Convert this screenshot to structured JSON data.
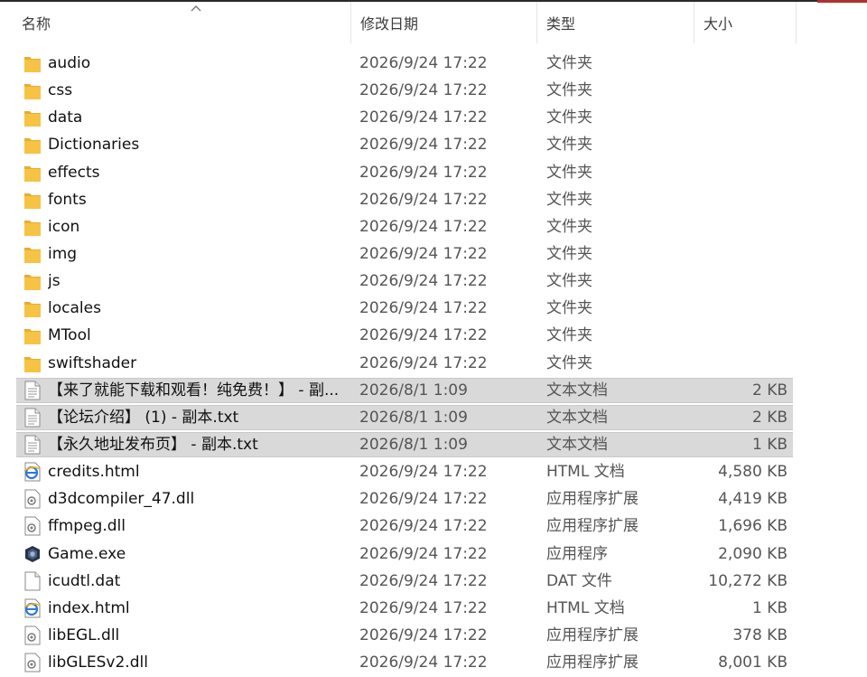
{
  "columns": {
    "name": "名称",
    "date": "修改日期",
    "type": "类型",
    "size": "大小"
  },
  "files": [
    {
      "name": "audio",
      "date": "2026/9/24 17:22",
      "type": "文件夹",
      "size": "",
      "icon": "folder-icon",
      "selected": false
    },
    {
      "name": "css",
      "date": "2026/9/24 17:22",
      "type": "文件夹",
      "size": "",
      "icon": "folder-icon",
      "selected": false
    },
    {
      "name": "data",
      "date": "2026/9/24 17:22",
      "type": "文件夹",
      "size": "",
      "icon": "folder-icon",
      "selected": false
    },
    {
      "name": "Dictionaries",
      "date": "2026/9/24 17:22",
      "type": "文件夹",
      "size": "",
      "icon": "folder-icon",
      "selected": false
    },
    {
      "name": "effects",
      "date": "2026/9/24 17:22",
      "type": "文件夹",
      "size": "",
      "icon": "folder-icon",
      "selected": false
    },
    {
      "name": "fonts",
      "date": "2026/9/24 17:22",
      "type": "文件夹",
      "size": "",
      "icon": "folder-icon",
      "selected": false
    },
    {
      "name": "icon",
      "date": "2026/9/24 17:22",
      "type": "文件夹",
      "size": "",
      "icon": "folder-icon",
      "selected": false
    },
    {
      "name": "img",
      "date": "2026/9/24 17:22",
      "type": "文件夹",
      "size": "",
      "icon": "folder-icon",
      "selected": false
    },
    {
      "name": "js",
      "date": "2026/9/24 17:22",
      "type": "文件夹",
      "size": "",
      "icon": "folder-icon",
      "selected": false
    },
    {
      "name": "locales",
      "date": "2026/9/24 17:22",
      "type": "文件夹",
      "size": "",
      "icon": "folder-icon",
      "selected": false
    },
    {
      "name": "MTool",
      "date": "2026/9/24 17:22",
      "type": "文件夹",
      "size": "",
      "icon": "folder-icon",
      "selected": false
    },
    {
      "name": "swiftshader",
      "date": "2026/9/24 17:22",
      "type": "文件夹",
      "size": "",
      "icon": "folder-icon",
      "selected": false
    },
    {
      "name": "【来了就能下载和观看！纯免费！】 - 副...",
      "date": "2026/8/1 1:09",
      "type": "文本文档",
      "size": "2 KB",
      "icon": "text-file-icon",
      "selected": true
    },
    {
      "name": "【论坛介绍】 (1) - 副本.txt",
      "date": "2026/8/1 1:09",
      "type": "文本文档",
      "size": "2 KB",
      "icon": "text-file-icon",
      "selected": true
    },
    {
      "name": "【永久地址发布页】 - 副本.txt",
      "date": "2026/8/1 1:09",
      "type": "文本文档",
      "size": "1 KB",
      "icon": "text-file-icon",
      "selected": true
    },
    {
      "name": "credits.html",
      "date": "2026/9/24 17:22",
      "type": "HTML 文档",
      "size": "4,580 KB",
      "icon": "html-file-icon",
      "selected": false
    },
    {
      "name": "d3dcompiler_47.dll",
      "date": "2026/9/24 17:22",
      "type": "应用程序扩展",
      "size": "4,419 KB",
      "icon": "dll-file-icon",
      "selected": false
    },
    {
      "name": "ffmpeg.dll",
      "date": "2026/9/24 17:22",
      "type": "应用程序扩展",
      "size": "1,696 KB",
      "icon": "dll-file-icon",
      "selected": false
    },
    {
      "name": "Game.exe",
      "date": "2026/9/24 17:22",
      "type": "应用程序",
      "size": "2,090 KB",
      "icon": "game-exe-icon",
      "selected": false
    },
    {
      "name": "icudtl.dat",
      "date": "2026/9/24 17:22",
      "type": "DAT 文件",
      "size": "10,272 KB",
      "icon": "blank-file-icon",
      "selected": false
    },
    {
      "name": "index.html",
      "date": "2026/9/24 17:22",
      "type": "HTML 文档",
      "size": "1 KB",
      "icon": "html-file-icon",
      "selected": false
    },
    {
      "name": "libEGL.dll",
      "date": "2026/9/24 17:22",
      "type": "应用程序扩展",
      "size": "378 KB",
      "icon": "dll-file-icon",
      "selected": false
    },
    {
      "name": "libGLESv2.dll",
      "date": "2026/9/24 17:22",
      "type": "应用程序扩展",
      "size": "8,001 KB",
      "icon": "dll-file-icon",
      "selected": false
    }
  ],
  "colors": {
    "folder": "#f6c344",
    "selection": "#d9d9d9",
    "html_icon": "#2a7ad8"
  }
}
